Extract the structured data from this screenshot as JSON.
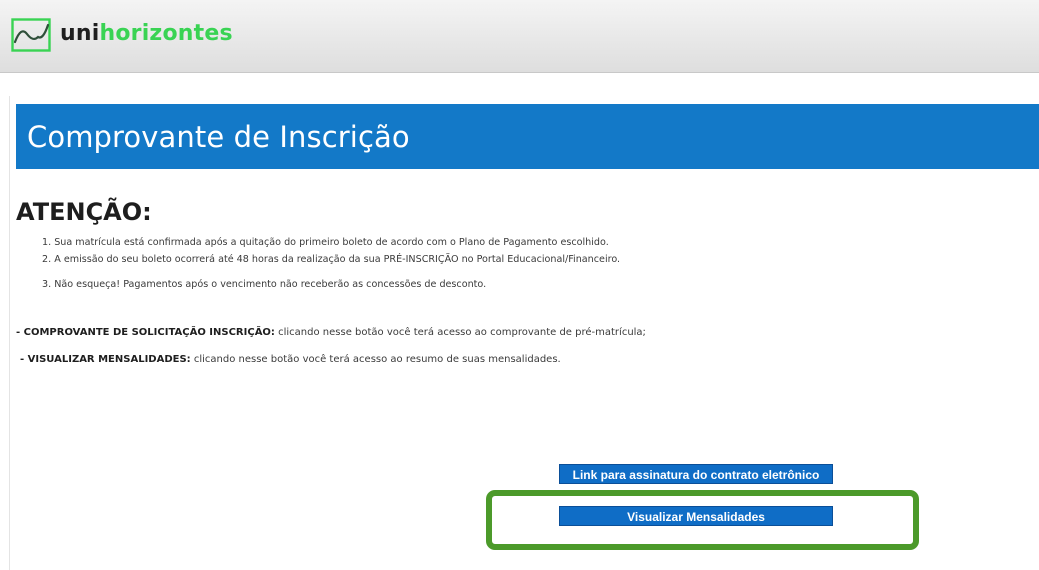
{
  "brand": {
    "name_part1": "uni",
    "name_part2": "horizontes",
    "logo_icon": "wave-chart-icon",
    "color_dark": "#1f1f1f",
    "color_green": "#39d353"
  },
  "page": {
    "title": "Comprovante de Inscrição",
    "title_bar_color": "#1379c8"
  },
  "attention": {
    "heading": "ATENÇÃO:",
    "notes": [
      "1. Sua matrícula está confirmada após a quitação do primeiro boleto de acordo com o Plano de Pagamento escolhido.",
      "2. A emissão do seu boleto ocorrerá até 48 horas da realização da sua PRÉ-INSCRIÇÃO no Portal Educacional/Financeiro.",
      "3. Não esqueça! Pagamentos após o vencimento não receberão as concessões de desconto."
    ]
  },
  "descriptions": [
    {
      "label": "- COMPROVANTE DE SOLICITAÇÃO INSCRIÇÃO:",
      "text": " clicando nesse botão você terá acesso ao comprovante de pré-matrícula;"
    },
    {
      "label": "- VISUALIZAR MENSALIDADES:",
      "text": " clicando nesse botão você terá acesso ao resumo de suas mensalidades."
    }
  ],
  "buttons": {
    "contract_link": "Link para assinatura do contrato eletrônico",
    "view_monthly": "Visualizar Mensalidades",
    "button_color": "#0f6dc6"
  },
  "annotation": {
    "highlight_color": "#4c9a2a"
  }
}
